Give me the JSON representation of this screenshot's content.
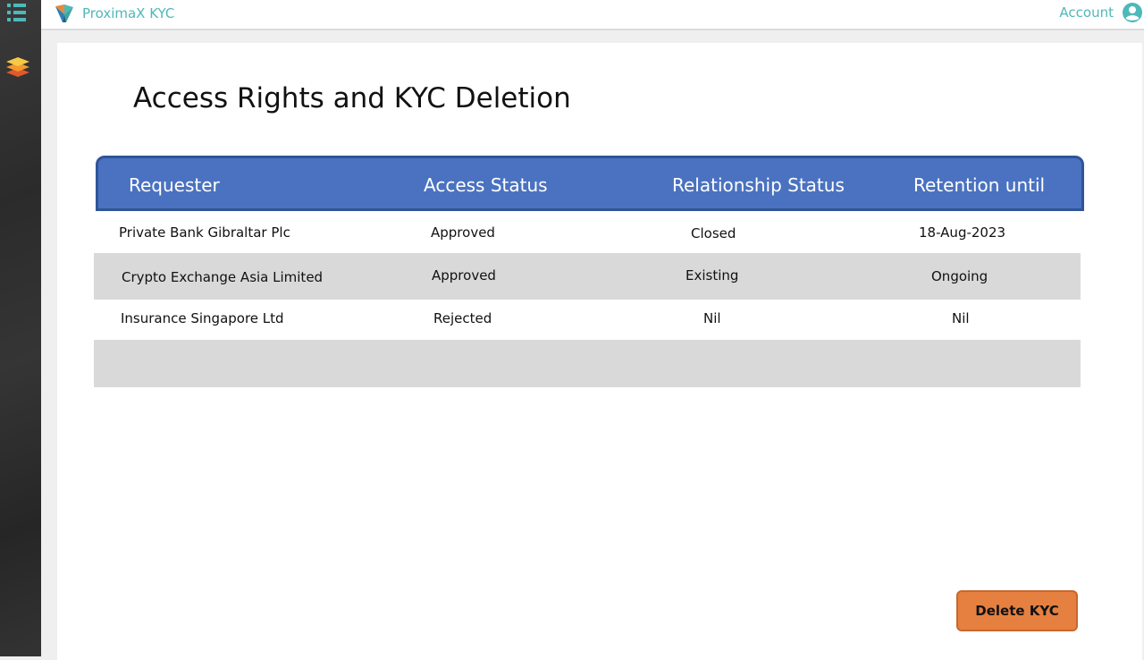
{
  "app": {
    "brand_name": "ProximaX KYC",
    "account_label": "Account",
    "accent_color": "#4fb8b8"
  },
  "sidebar": {
    "items": [
      {
        "icon": "list-menu-icon"
      },
      {
        "icon": "layers-icon"
      }
    ]
  },
  "page": {
    "title": "Access Rights and KYC Deletion"
  },
  "table": {
    "header_color": "#4a72c0",
    "columns": [
      "Requester",
      "Access Status",
      "Relationship Status",
      "Retention until"
    ],
    "rows": [
      [
        "Private Bank Gibraltar Plc",
        "Approved",
        "Closed",
        "18-Aug-2023"
      ],
      [
        "Crypto Exchange Asia Limited",
        "Approved",
        "Existing",
        "Ongoing"
      ],
      [
        "Insurance Singapore Ltd",
        "Rejected",
        "Nil",
        "Nil"
      ],
      [
        "",
        "",
        "",
        ""
      ]
    ]
  },
  "actions": {
    "delete_label": "Delete KYC",
    "delete_color": "#e58040"
  }
}
